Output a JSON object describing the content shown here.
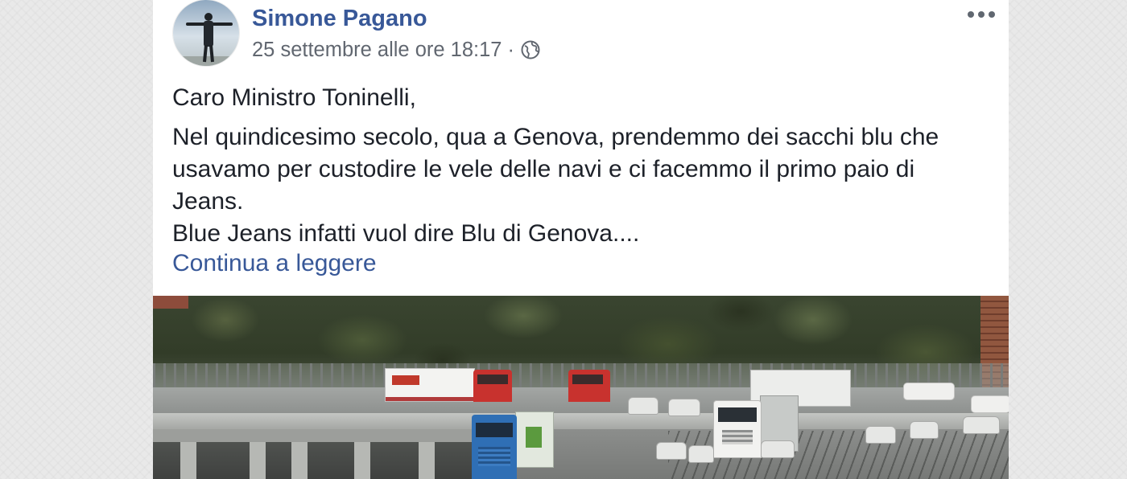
{
  "post": {
    "author_name": "Simone Pagano",
    "timestamp": "25 settembre alle ore 18:17",
    "separator": "·",
    "greeting": "Caro Ministro Toninelli,",
    "body_lines": [
      "Nel quindicesimo secolo, qua a Genova, prendemmo dei sacchi blu che",
      "usavamo per custodire le vele delle navi e ci facemmo il primo paio di",
      "Jeans.",
      "Blue Jeans infatti vuol dire Blu di Genova...."
    ],
    "see_more": "Continua a leggere"
  },
  "icons": {
    "privacy": "globe-icon",
    "options": "more-options-icon"
  },
  "colors": {
    "link": "#385898",
    "text": "#1d2129",
    "meta": "#616770",
    "card": "#ffffff",
    "page_background": "#e9e9e9"
  }
}
